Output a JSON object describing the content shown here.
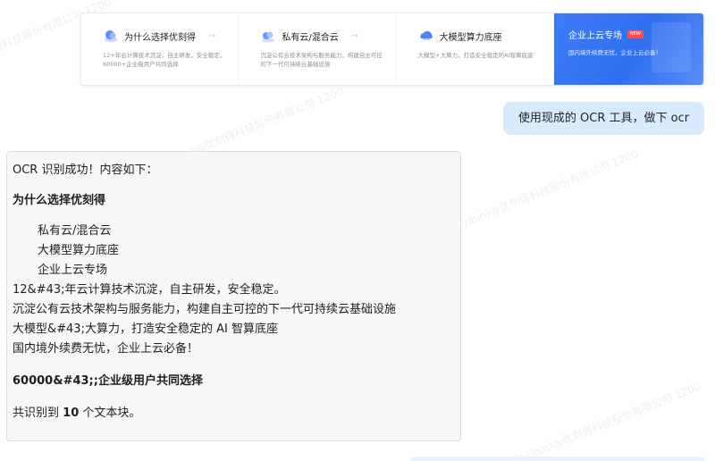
{
  "screenshot_cards": [
    {
      "title": "为什么选择优刻得",
      "desc_lines": [
        "12+年云计算技术沉淀，自主研发，安全稳定，",
        "60000+企业级用户共同选择"
      ],
      "icon": "cloud-stack-icon",
      "arrow": "→"
    },
    {
      "title": "私有云/混合云",
      "desc_lines": [
        "沉淀公有云技术架构与服务能力，构建自主可控",
        "的下一代可持续云基础设施"
      ],
      "icon": "cloud-server-icon",
      "arrow": "→"
    },
    {
      "title": "大模型算力底座",
      "desc_lines": [
        "大模型+大算力，打造安全稳定的AI智算底座"
      ],
      "icon": "cloud-compute-icon",
      "arrow": ""
    },
    {
      "title": "企业上云专场",
      "badge": "NEW",
      "desc_lines": [
        "国内境外续费无忧，企业上云必备！"
      ],
      "icon": "",
      "arrow": ""
    }
  ],
  "user_message": "使用现成的 OCR 工具，做下 ocr",
  "assistant": {
    "intro": "OCR 识别成功！内容如下：",
    "heading": "为什么选择优刻得",
    "items": [
      "私有云/混合云",
      "大模型算力底座",
      "企业上云专场"
    ],
    "lines": [
      "12&#43;年云计算技术沉淀，自主研发，安全稳定。",
      "沉淀公有云技术架构与服务能力，构建自主可控的下一代可持续云基础设施",
      "大模型&#43;大算力，打造安全稳定的 AI 智算底座",
      "国内境外续费无忧，企业上云必备！"
    ],
    "users_line": "60000&#43;;企业级用户共同选择",
    "summary_prefix": "共识别到",
    "summary_count": "10",
    "summary_suffix": "个文本块。"
  },
  "watermark_text": "钱荣荣(yibin)@优刻得科技股份有限公司 1200",
  "colors": {
    "accent_blue": "#2f6ff0",
    "user_bubble": "#d8ebfd",
    "assistant_bg": "#f7f7f7"
  }
}
